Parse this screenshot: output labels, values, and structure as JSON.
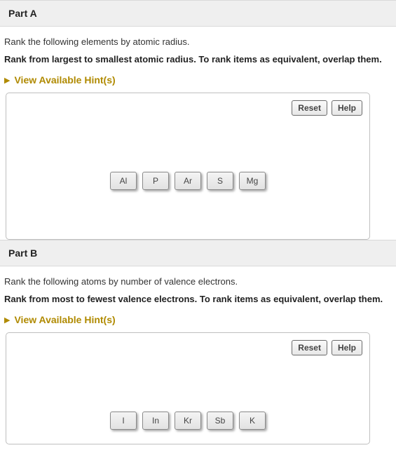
{
  "partA": {
    "title": "Part A",
    "instruction": "Rank the following elements by atomic radius.",
    "instructionBold": "Rank from largest to smallest atomic radius. To rank items as equivalent, overlap them.",
    "hintsLabel": "View Available Hint(s)",
    "resetLabel": "Reset",
    "helpLabel": "Help",
    "tiles": [
      "Al",
      "P",
      "Ar",
      "S",
      "Mg"
    ]
  },
  "partB": {
    "title": "Part B",
    "instruction": "Rank the following atoms by number of valence electrons.",
    "instructionBold": "Rank from most to fewest valence electrons. To rank items as equivalent, overlap them.",
    "hintsLabel": "View Available Hint(s)",
    "resetLabel": "Reset",
    "helpLabel": "Help",
    "tiles": [
      "I",
      "In",
      "Kr",
      "Sb",
      "K"
    ]
  }
}
